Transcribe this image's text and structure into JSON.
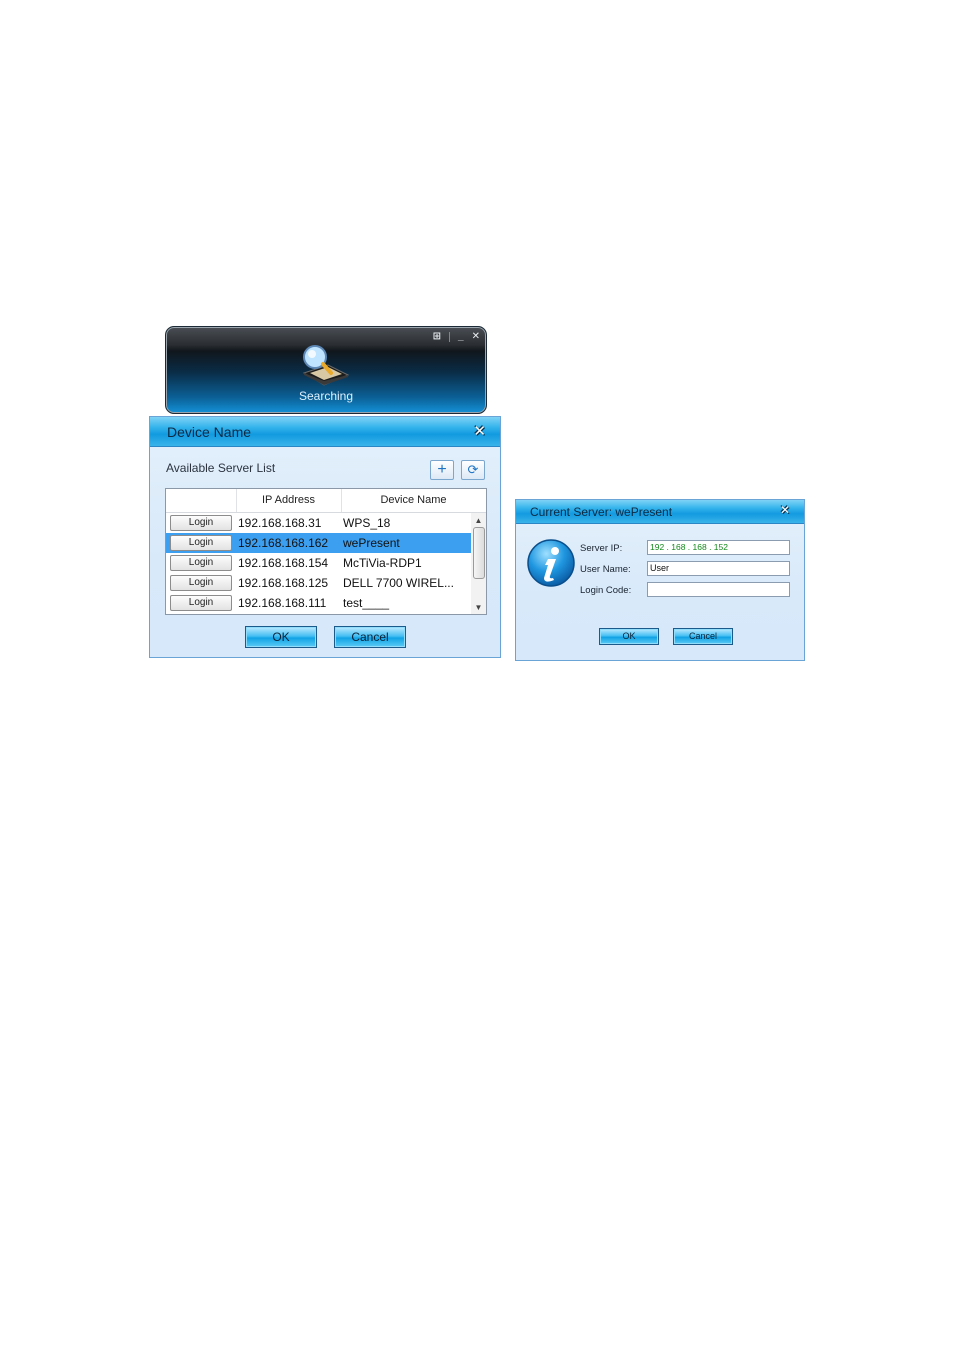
{
  "searching_widget": {
    "status_label": "Searching",
    "controls": {
      "menu": "⊞",
      "minimize": "_",
      "close": "✕"
    }
  },
  "device_dialog": {
    "title": "Device Name",
    "close_glyph": "✕",
    "list_label": "Available Server List",
    "add_glyph": "+",
    "refresh_glyph": "⟳",
    "columns": [
      "",
      "IP Address",
      "Device Name"
    ],
    "rows": [
      {
        "button": "Login",
        "ip": "192.168.168.31",
        "name": "WPS_18"
      },
      {
        "button": "Login",
        "ip": "192.168.168.162",
        "name": "wePresent"
      },
      {
        "button": "Login",
        "ip": "192.168.168.154",
        "name": "McTiVia-RDP1"
      },
      {
        "button": "Login",
        "ip": "192.168.168.125",
        "name": "DELL 7700 WIREL..."
      },
      {
        "button": "Login",
        "ip": "192.168.168.111",
        "name": "test____"
      }
    ],
    "selected_row": 1,
    "ok_label": "OK",
    "cancel_label": "Cancel"
  },
  "current_server_dialog": {
    "title": "Current Server: wePresent",
    "close_glyph": "✕",
    "server_ip_label": "Server IP:",
    "server_ip_value": "192 . 168 . 168 . 152",
    "user_name_label": "User Name:",
    "user_name_value": "User",
    "login_code_label": "Login Code:",
    "login_code_value": "",
    "ok_label": "OK",
    "cancel_label": "Cancel"
  },
  "colors": {
    "titlebar_blue": "#129ae0",
    "selection_blue": "#3c9ff0",
    "dialog_bg": "#d8e9fa",
    "ip_text_green": "#138a1a"
  }
}
